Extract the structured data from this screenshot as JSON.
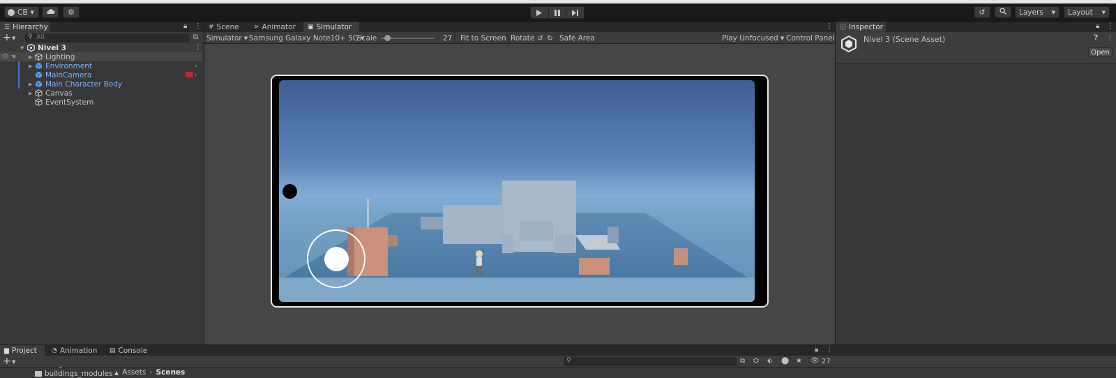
{
  "toolbar": {
    "account_label": "CB",
    "layers_label": "Layers",
    "layout_label": "Layout"
  },
  "hierarchy": {
    "tab_label": "Hierarchy",
    "search_placeholder": "All",
    "scene_name": "Nivel 3",
    "items": [
      {
        "label": "Lighting"
      },
      {
        "label": "Environment"
      },
      {
        "label": "MainCamera"
      },
      {
        "label": "Main Character Body"
      },
      {
        "label": "Canvas"
      },
      {
        "label": "EventSystem"
      }
    ]
  },
  "center": {
    "tabs": [
      {
        "label": "Scene"
      },
      {
        "label": "Animator"
      },
      {
        "label": "Simulator"
      }
    ],
    "simulator_mode": "Simulator",
    "device": "Samsung Galaxy Note10+ 5G",
    "scale_label": "Scale",
    "scale_value": "27",
    "scale_fraction": 0.12,
    "fit_to_screen": "Fit to Screen",
    "rotate_label": "Rotate",
    "safe_area": "Safe Area",
    "play_mode": "Play Unfocused",
    "control_panel": "Control Panel"
  },
  "inspector": {
    "tab_label": "Inspector",
    "asset_title": "Nivel 3 (Scene Asset)",
    "open_button": "Open"
  },
  "bottom": {
    "tabs": [
      {
        "label": "Project"
      },
      {
        "label": "Animation"
      },
      {
        "label": "Console"
      }
    ],
    "folder_partial": "buildings",
    "folder_item": "buildings_modules",
    "breadcrumb": [
      "Assets",
      "Scenes"
    ],
    "visibility_count": "27"
  },
  "colors": {
    "accent_blue": "#7cb0ff",
    "panel": "#383838",
    "toolbar": "#191919"
  }
}
